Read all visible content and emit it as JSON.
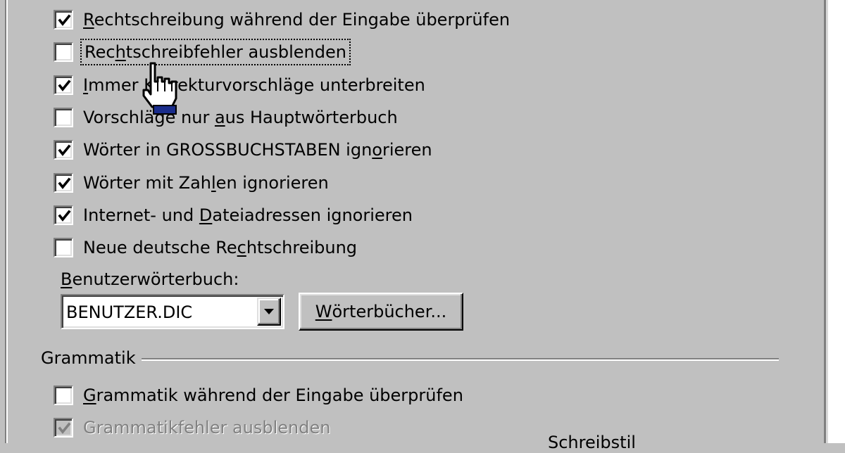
{
  "spelling_options": [
    {
      "label": "Rechtschreibung während der Eingabe überprüfen",
      "checked": true,
      "disabled": false,
      "focused": false,
      "mnemonic_index": 0
    },
    {
      "label": "Rechtschreibfehler ausblenden",
      "checked": false,
      "disabled": false,
      "focused": true,
      "mnemonic_index": 3
    },
    {
      "label": "Immer Korrekturvorschläge unterbreiten",
      "checked": true,
      "disabled": false,
      "focused": false,
      "mnemonic_index": 0
    },
    {
      "label": "Vorschläge nur aus Hauptwörterbuch",
      "checked": false,
      "disabled": false,
      "focused": false,
      "mnemonic_index": 15
    },
    {
      "label": "Wörter in GROSSBUCHSTABEN ignorieren",
      "checked": true,
      "disabled": false,
      "focused": false,
      "mnemonic_index": 29
    },
    {
      "label": "Wörter mit Zahlen ignorieren",
      "checked": true,
      "disabled": false,
      "focused": false,
      "mnemonic_index": 14
    },
    {
      "label": "Internet- und Dateiadressen ignorieren",
      "checked": true,
      "disabled": false,
      "focused": false,
      "mnemonic_index": 14
    },
    {
      "label": "Neue deutsche Rechtschreibung",
      "checked": false,
      "disabled": false,
      "focused": false,
      "mnemonic_index": 16
    }
  ],
  "custom_dictionary": {
    "label": "Benutzerwörterbuch:",
    "value": "BENUTZER.DIC",
    "button_label": "Wörterbücher..."
  },
  "grammar": {
    "group_title": "Grammatik",
    "options": [
      {
        "label": "Grammatik während der Eingabe überprüfen",
        "checked": false,
        "disabled": false,
        "focused": false,
        "mnemonic_index": 0
      },
      {
        "label": "Grammatikfehler ausblenden",
        "checked": true,
        "disabled": true,
        "focused": false,
        "mnemonic_index": -1
      }
    ]
  },
  "bottom_fragment": "Schreibstil",
  "colors": {
    "face": "#c0c0c0",
    "shadow": "#808080",
    "highlight": "#ffffff",
    "disabled_text": "#808080",
    "cursor_cuff": "#1a2d8c"
  },
  "cursor": {
    "icon": "hand-pointer-icon"
  }
}
